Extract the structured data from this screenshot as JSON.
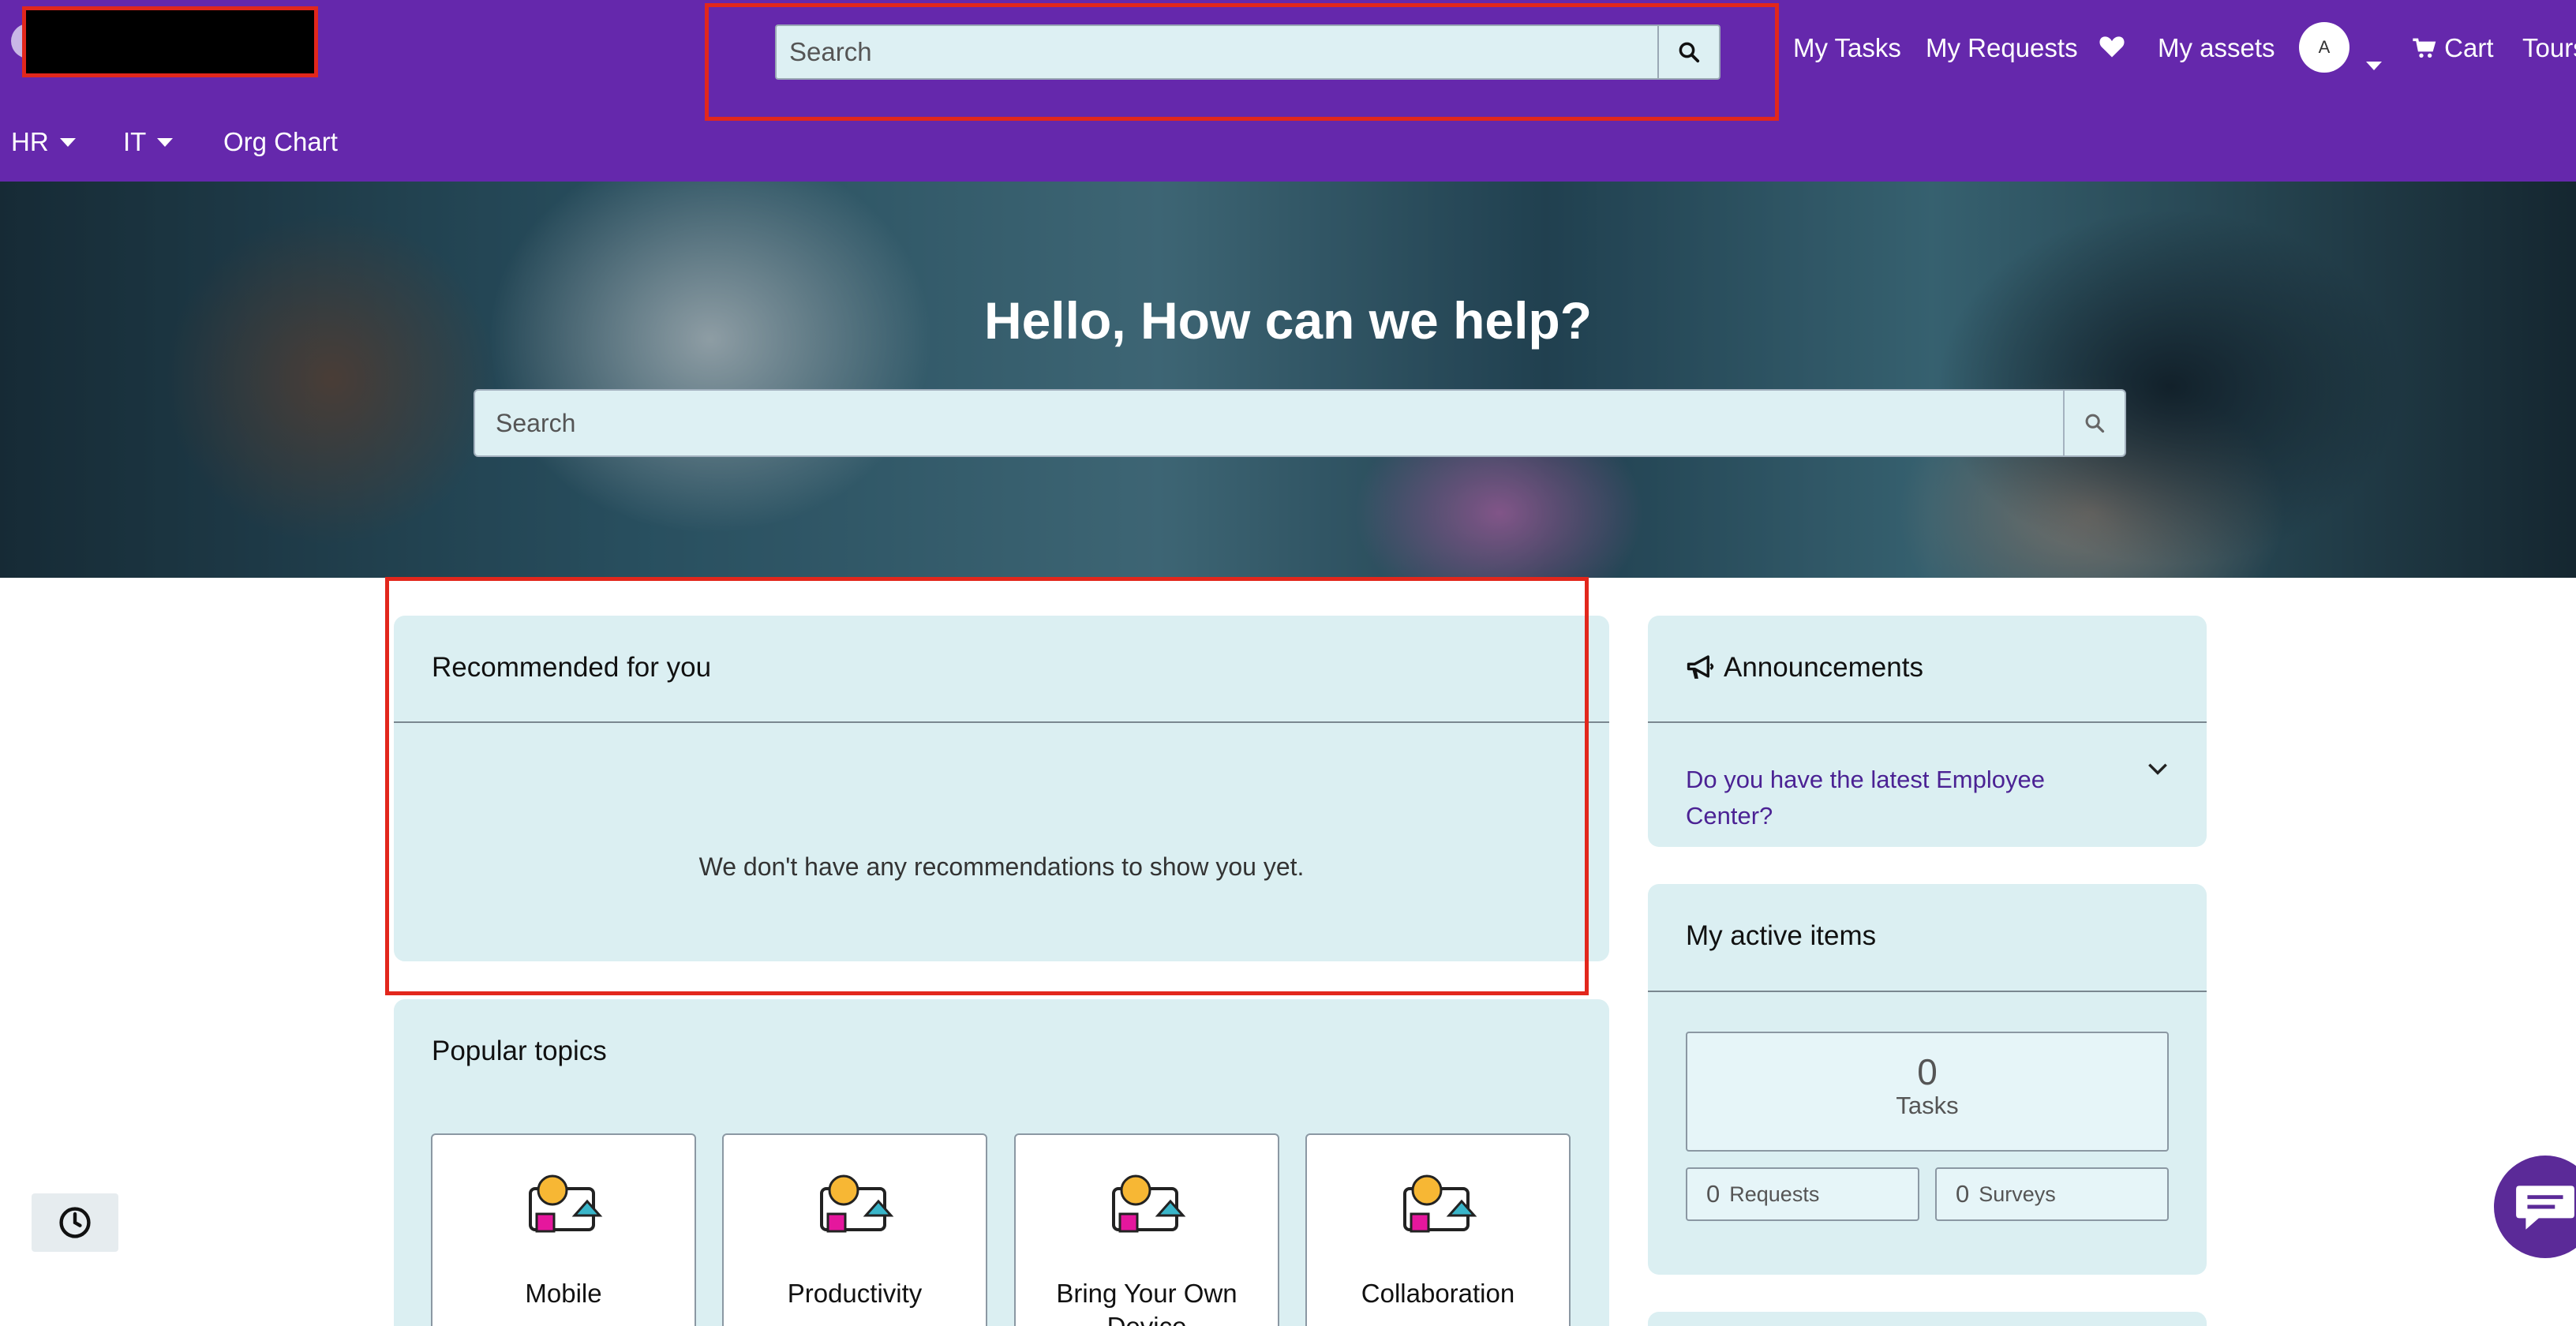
{
  "header": {
    "search_placeholder": "Search",
    "nav": {
      "my_tasks": "My Tasks",
      "my_requests": "My Requests",
      "my_assets": "My assets",
      "avatar_initial": "A",
      "cart": "Cart",
      "tours": "Tours"
    },
    "subnav": {
      "hr": "HR",
      "it": "IT",
      "org_chart": "Org Chart"
    }
  },
  "hero": {
    "title": "Hello, How can we help?",
    "search_placeholder": "Search"
  },
  "recommended": {
    "title": "Recommended for you",
    "empty_message": "We don't have any recommendations to show you yet."
  },
  "popular_topics": {
    "title": "Popular topics",
    "topics": [
      {
        "label": "Mobile"
      },
      {
        "label": "Productivity"
      },
      {
        "label": "Bring Your Own Device"
      },
      {
        "label": "Collaboration"
      }
    ]
  },
  "announcements": {
    "title": "Announcements",
    "item": "Do you have the latest Employee Center?"
  },
  "active_items": {
    "title": "My active items",
    "tasks_count": "0",
    "tasks_label": "Tasks",
    "requests_count": "0",
    "requests_label": "Requests",
    "surveys_count": "0",
    "surveys_label": "Surveys"
  },
  "colors": {
    "header_bg": "#6528ac",
    "card_bg": "#dbeff2",
    "highlight": "#e2271c",
    "link": "#4b2294"
  }
}
